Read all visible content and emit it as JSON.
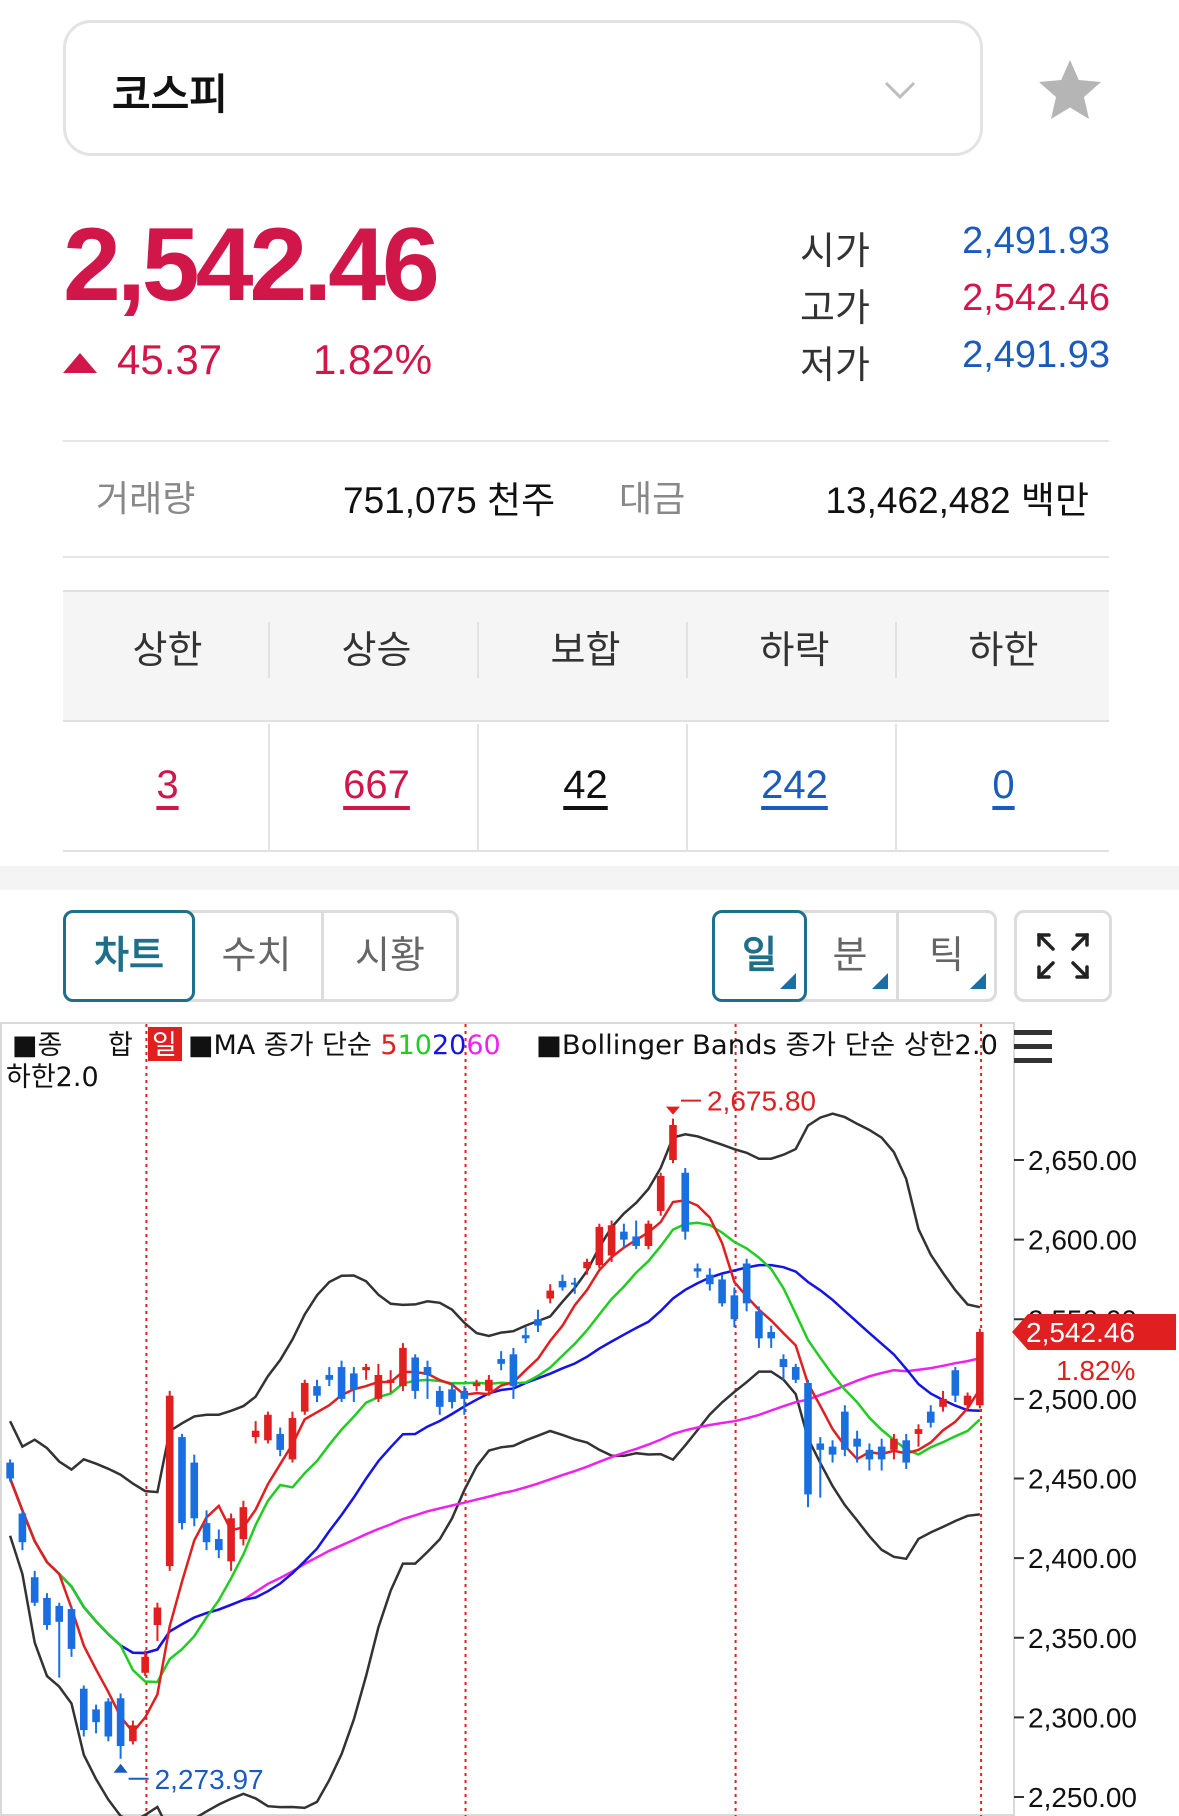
{
  "market_selector": {
    "label": "코스피",
    "dropdown_icon": "chevron-down-icon",
    "favorite_icon": "star-icon"
  },
  "quote": {
    "price": "2,542.46",
    "change": "45.37",
    "change_rate": "1.82%",
    "direction": "up",
    "open_label": "시가",
    "open": "2,491.93",
    "high_label": "고가",
    "high": "2,542.46",
    "low_label": "저가",
    "low": "2,491.93"
  },
  "trading": {
    "volume_label": "거래량",
    "volume": "751,075 천주",
    "amount_label": "대금",
    "amount": "13,462,482 백만"
  },
  "breadth": {
    "headers": [
      "상한",
      "상승",
      "보합",
      "하락",
      "하한"
    ],
    "values": [
      "3",
      "667",
      "42",
      "242",
      "0"
    ]
  },
  "tabs": {
    "view": [
      "차트",
      "수치",
      "시황"
    ],
    "period": [
      "일",
      "분",
      "틱"
    ],
    "fullscreen_icon": "expand-icon"
  },
  "colors": {
    "up": "#d1164a",
    "down": "#1a5bbd",
    "accent": "#1f6f8b"
  },
  "chart_legend": {
    "seg1": "■종",
    "seg2": "합",
    "period_badge": "일",
    "ma": "■MA 종가 단순",
    "ma5": "5",
    "ma10": "10",
    "ma20": "20",
    "ma60": "60",
    "bb": "■Bollinger Bands 종가 단순 상한2.0",
    "bb_line2": "하한2.0",
    "menu_icon": "hamburger-icon"
  },
  "chart_data": {
    "type": "candlestick",
    "y_ticks": [
      "2,650.00",
      "2,600.00",
      "2,550.00",
      "2,500.00",
      "2,450.00",
      "2,400.00",
      "2,350.00",
      "2,300.00",
      "2,250.00"
    ],
    "ylim": [
      2245,
      2700
    ],
    "max_marker": "2,675.80",
    "min_marker": "2,273.97",
    "current_label": "2,542.46",
    "current_change": "1.82%",
    "ohlc": [
      [
        2460,
        2462,
        2448,
        2450
      ],
      [
        2428,
        2430,
        2405,
        2410
      ],
      [
        2388,
        2392,
        2370,
        2372
      ],
      [
        2375,
        2378,
        2355,
        2358
      ],
      [
        2370,
        2372,
        2325,
        2360
      ],
      [
        2368,
        2370,
        2338,
        2343
      ],
      [
        2318,
        2320,
        2288,
        2292
      ],
      [
        2305,
        2308,
        2290,
        2297
      ],
      [
        2310,
        2312,
        2285,
        2288
      ],
      [
        2312,
        2315,
        2274,
        2282
      ],
      [
        2285,
        2298,
        2283,
        2295
      ],
      [
        2328,
        2342,
        2326,
        2338
      ],
      [
        2358,
        2372,
        2348,
        2369
      ],
      [
        2395,
        2505,
        2392,
        2502
      ],
      [
        2476,
        2478,
        2418,
        2422
      ],
      [
        2460,
        2465,
        2420,
        2425
      ],
      [
        2422,
        2430,
        2405,
        2410
      ],
      [
        2412,
        2418,
        2400,
        2405
      ],
      [
        2398,
        2428,
        2392,
        2425
      ],
      [
        2412,
        2436,
        2408,
        2432
      ],
      [
        2476,
        2486,
        2472,
        2480
      ],
      [
        2474,
        2492,
        2472,
        2490
      ],
      [
        2478,
        2482,
        2464,
        2468
      ],
      [
        2462,
        2492,
        2460,
        2488
      ],
      [
        2492,
        2512,
        2490,
        2510
      ],
      [
        2508,
        2512,
        2498,
        2502
      ],
      [
        2515,
        2520,
        2508,
        2512
      ],
      [
        2520,
        2524,
        2498,
        2500
      ],
      [
        2516,
        2520,
        2498,
        2506
      ],
      [
        2518,
        2522,
        2512,
        2520
      ],
      [
        2500,
        2522,
        2498,
        2515
      ],
      [
        2510,
        2518,
        2504,
        2512
      ],
      [
        2508,
        2535,
        2505,
        2532
      ],
      [
        2526,
        2528,
        2500,
        2505
      ],
      [
        2520,
        2524,
        2500,
        2515
      ],
      [
        2505,
        2508,
        2490,
        2495
      ],
      [
        2506,
        2510,
        2494,
        2498
      ],
      [
        2505,
        2508,
        2490,
        2500
      ],
      [
        2508,
        2512,
        2505,
        2510
      ],
      [
        2505,
        2515,
        2502,
        2512
      ],
      [
        2525,
        2530,
        2518,
        2522
      ],
      [
        2528,
        2532,
        2500,
        2508
      ],
      [
        2540,
        2545,
        2535,
        2538
      ],
      [
        2550,
        2556,
        2542,
        2546
      ],
      [
        2563,
        2572,
        2560,
        2568
      ],
      [
        2574,
        2578,
        2568,
        2570
      ],
      [
        2573,
        2576,
        2566,
        2572
      ],
      [
        2582,
        2588,
        2578,
        2586
      ],
      [
        2584,
        2610,
        2582,
        2608
      ],
      [
        2590,
        2612,
        2586,
        2609
      ],
      [
        2605,
        2610,
        2595,
        2600
      ],
      [
        2602,
        2612,
        2594,
        2596
      ],
      [
        2596,
        2612,
        2594,
        2610
      ],
      [
        2618,
        2642,
        2615,
        2640
      ],
      [
        2650,
        2676,
        2648,
        2672
      ],
      [
        2642,
        2645,
        2600,
        2605
      ],
      [
        2582,
        2585,
        2576,
        2580
      ],
      [
        2578,
        2582,
        2568,
        2572
      ],
      [
        2575,
        2578,
        2558,
        2560
      ],
      [
        2565,
        2570,
        2545,
        2550
      ],
      [
        2585,
        2588,
        2555,
        2560
      ],
      [
        2555,
        2558,
        2532,
        2538
      ],
      [
        2542,
        2546,
        2532,
        2538
      ],
      [
        2525,
        2528,
        2512,
        2520
      ],
      [
        2520,
        2522,
        2510,
        2512
      ],
      [
        2510,
        2512,
        2432,
        2440
      ],
      [
        2472,
        2476,
        2438,
        2468
      ],
      [
        2470,
        2474,
        2460,
        2465
      ],
      [
        2492,
        2496,
        2464,
        2468
      ],
      [
        2475,
        2480,
        2460,
        2470
      ],
      [
        2468,
        2472,
        2455,
        2462
      ],
      [
        2470,
        2475,
        2455,
        2462
      ],
      [
        2468,
        2478,
        2462,
        2475
      ],
      [
        2474,
        2478,
        2456,
        2460
      ],
      [
        2478,
        2484,
        2470,
        2481
      ],
      [
        2492,
        2496,
        2482,
        2485
      ],
      [
        2495,
        2505,
        2492,
        2500
      ],
      [
        2518,
        2520,
        2498,
        2502
      ],
      [
        2496,
        2504,
        2494,
        2502
      ],
      [
        2496,
        2544,
        2494,
        2542
      ]
    ]
  }
}
